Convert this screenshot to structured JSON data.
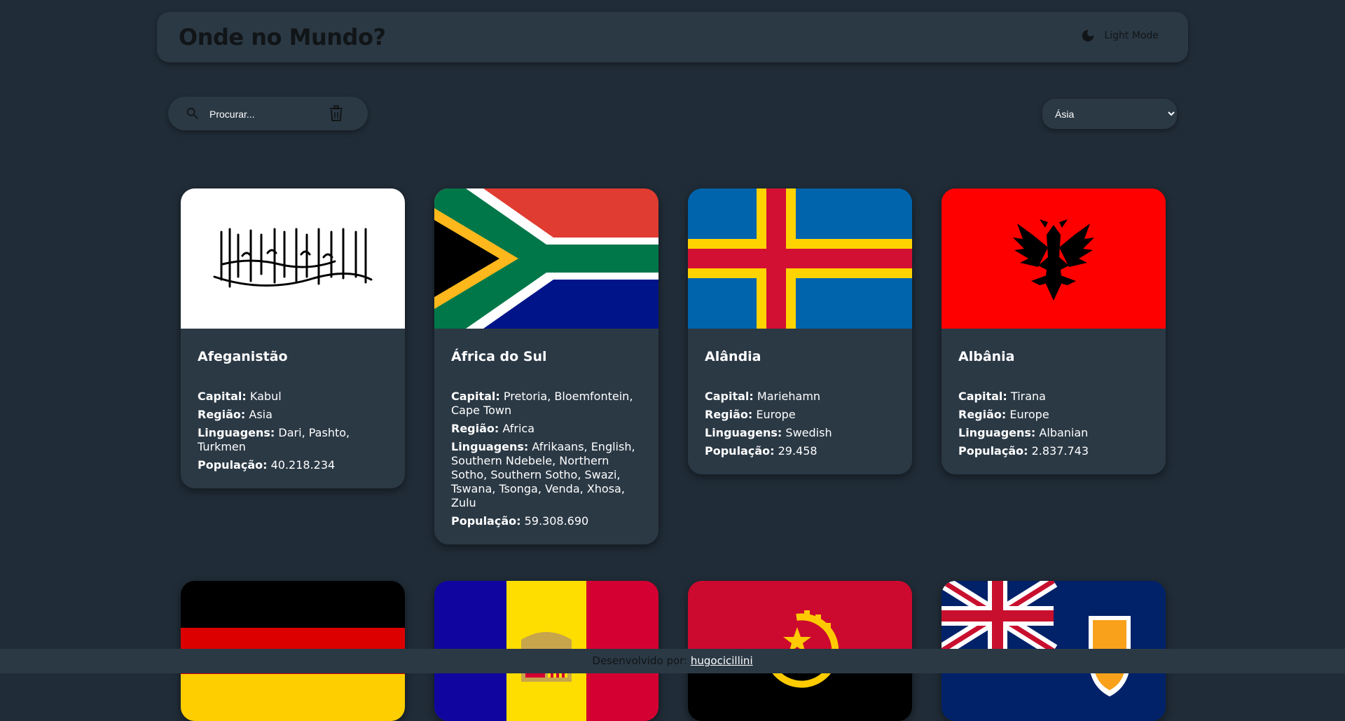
{
  "header": {
    "title": "Onde no Mundo?",
    "mode_label": "Light Mode"
  },
  "search": {
    "placeholder": "Procurar...",
    "value": ""
  },
  "filter": {
    "selected": "Ásia"
  },
  "countries": [
    {
      "name": "Afeganistão",
      "capital_label": "Capital:",
      "capital": "Kabul",
      "region_label": "Região:",
      "region": "Asia",
      "languages_label": "Linguagens:",
      "languages": "Dari, Pashto, Turkmen",
      "population_label": "População:",
      "population": "40.218.234"
    },
    {
      "name": "África do Sul",
      "capital_label": "Capital:",
      "capital": "Pretoria, Bloemfontein, Cape Town",
      "region_label": "Região:",
      "region": "Africa",
      "languages_label": "Linguagens:",
      "languages": "Afrikaans, English, Southern Ndebele, Northern Sotho, Southern Sotho, Swazi, Tswana, Tsonga, Venda, Xhosa, Zulu",
      "population_label": "População:",
      "population": "59.308.690"
    },
    {
      "name": "Alândia",
      "capital_label": "Capital:",
      "capital": "Mariehamn",
      "region_label": "Região:",
      "region": "Europe",
      "languages_label": "Linguagens:",
      "languages": "Swedish",
      "population_label": "População:",
      "population": "29.458"
    },
    {
      "name": "Albânia",
      "capital_label": "Capital:",
      "capital": "Tirana",
      "region_label": "Região:",
      "region": "Europe",
      "languages_label": "Linguagens:",
      "languages": "Albanian",
      "population_label": "População:",
      "population": "2.837.743"
    }
  ],
  "footer": {
    "text": "Desenvolvido por:",
    "author": "hugocicillini"
  },
  "colors": {
    "background": "#202c37",
    "element": "#2b3945",
    "dark_text": "#111517",
    "text": "#ffffff"
  },
  "icons": [
    "moon-icon",
    "search-icon",
    "trash-icon"
  ]
}
